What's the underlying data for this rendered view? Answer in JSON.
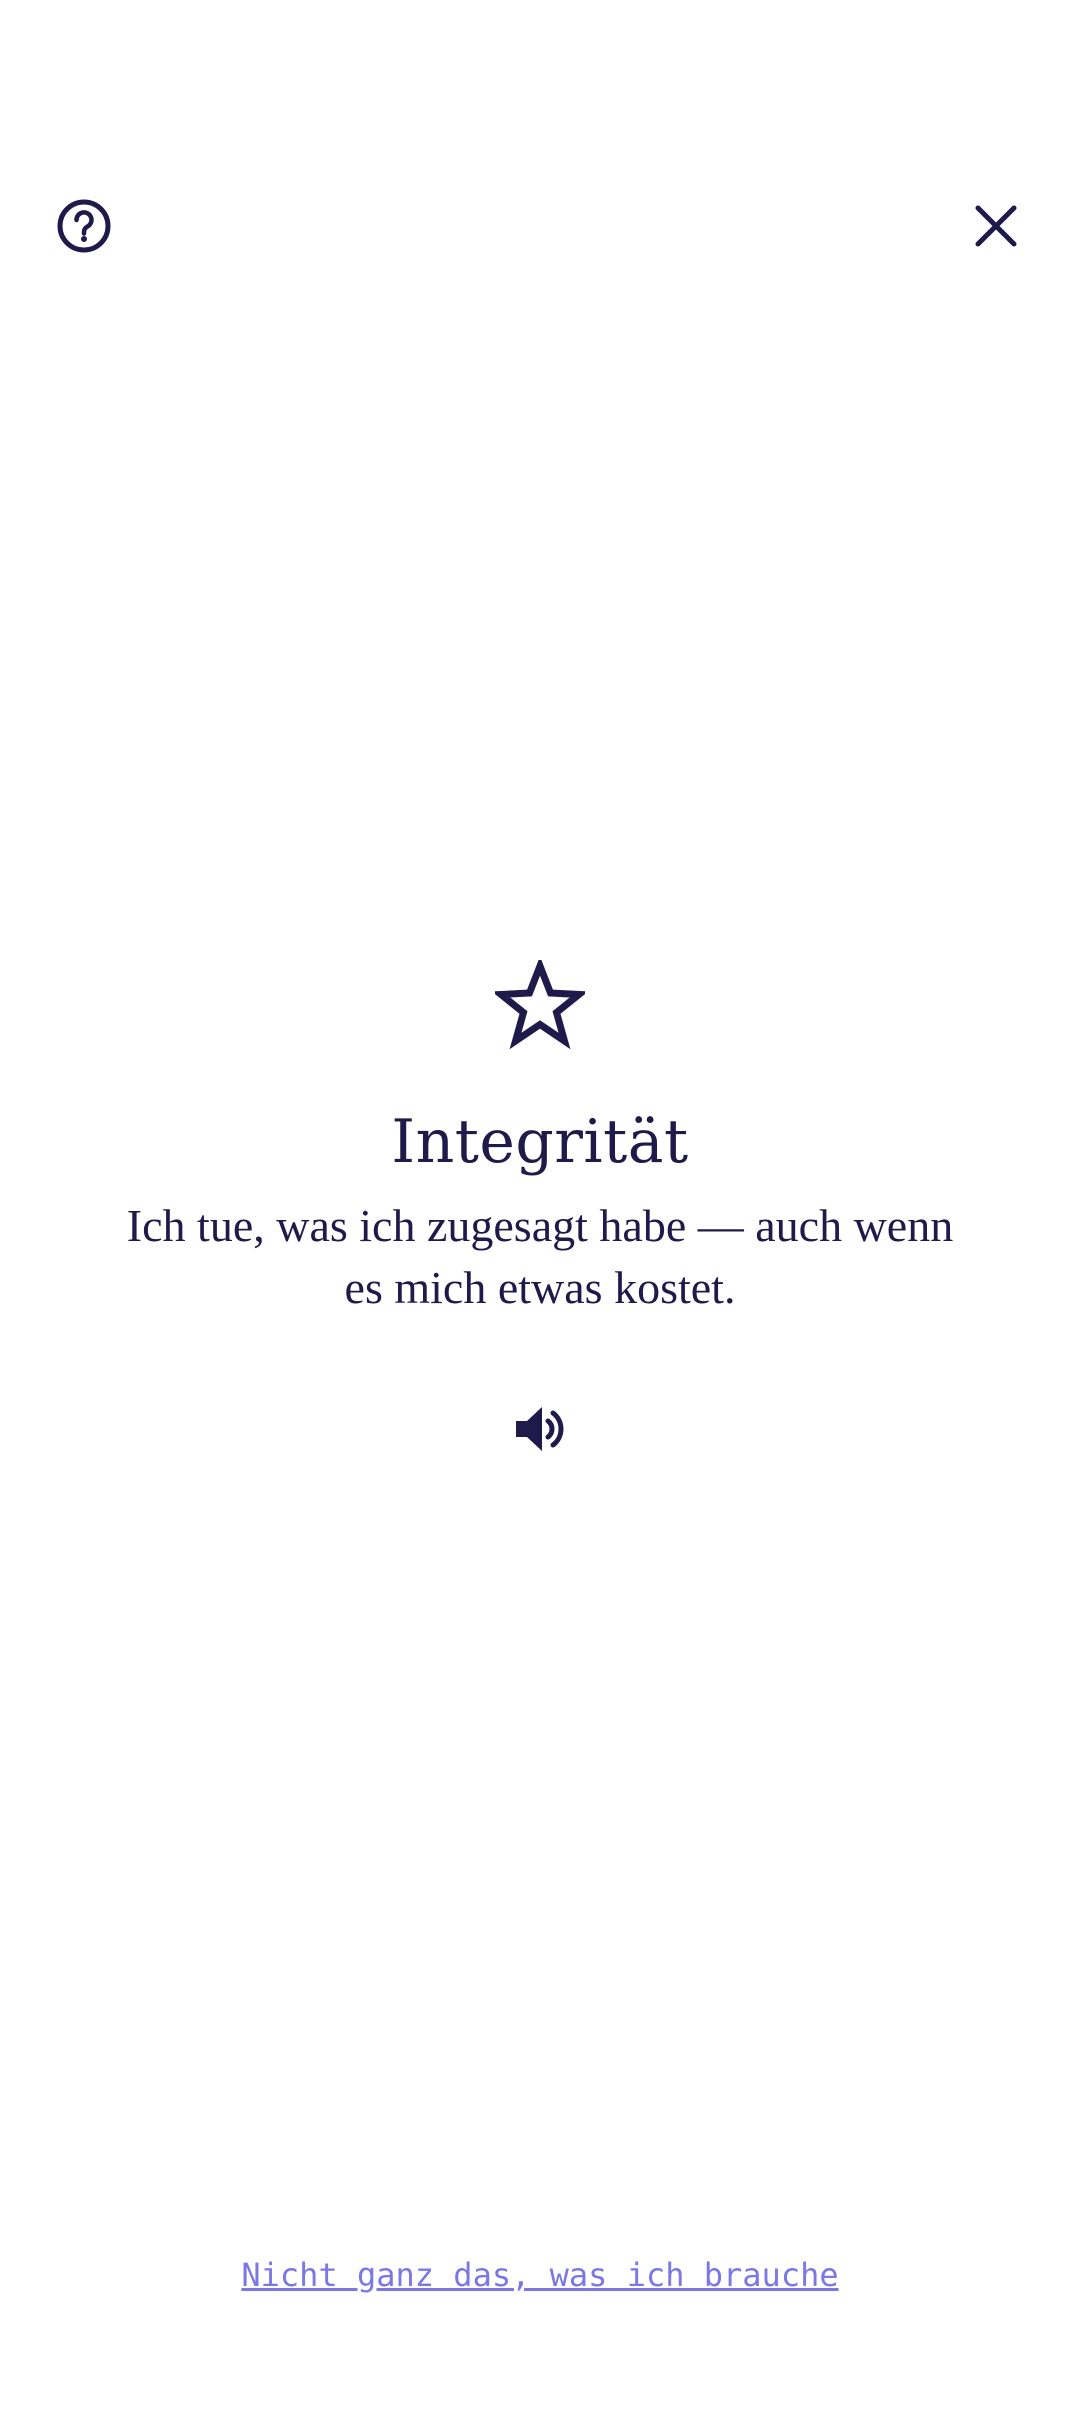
{
  "header": {
    "help_icon": "help-circle-icon",
    "close_icon": "close-icon"
  },
  "value_card": {
    "icon": "star-outline-icon",
    "title": "Integrität",
    "description": "Ich tue, was ich zugesagt habe — auch wenn es mich etwas kostet.",
    "audio_icon": "speaker-icon"
  },
  "footer": {
    "link_label": "Nicht ganz das, was ich brauche"
  },
  "colors": {
    "ink": "#1f1a4a",
    "link": "#7b78e6",
    "background": "#ffffff"
  }
}
